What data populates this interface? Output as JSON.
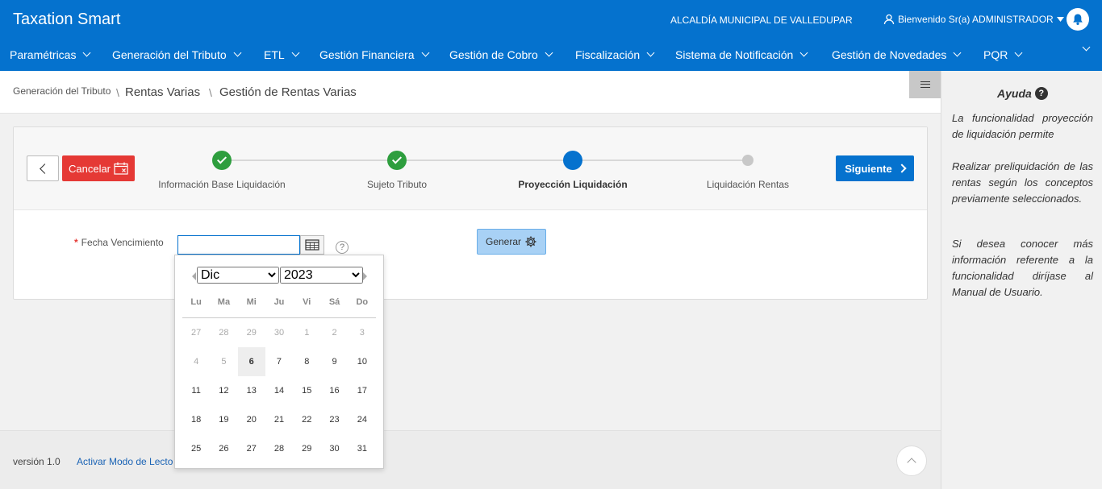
{
  "header": {
    "app_title": "Taxation Smart",
    "organization": "ALCALDÍA MUNICIPAL DE VALLEDUPAR",
    "user_greeting": "Bienvenido Sr(a) ADMINISTRADOR",
    "accent": "#0572ce"
  },
  "menu": {
    "items": [
      {
        "label": "Paramétricas"
      },
      {
        "label": "Generación del Tributo"
      },
      {
        "label": "ETL"
      },
      {
        "label": "Gestión Financiera"
      },
      {
        "label": "Gestión de Cobro"
      },
      {
        "label": "Fiscalización"
      },
      {
        "label": "Sistema de Notificación"
      },
      {
        "label": "Gestión de Novedades"
      },
      {
        "label": "PQR"
      }
    ]
  },
  "breadcrumb": {
    "level1": "Generación del Tributo",
    "level2": "Rentas Varias",
    "level3": "Gestión de Rentas Varias"
  },
  "wizard": {
    "cancel_label": "Cancelar",
    "next_label": "Siguiente",
    "steps": [
      {
        "label": "Información Base Liquidación",
        "status": "done"
      },
      {
        "label": "Sujeto Tributo",
        "status": "done"
      },
      {
        "label": "Proyección Liquidación",
        "status": "current"
      },
      {
        "label": "Liquidación Rentas",
        "status": "pending"
      }
    ]
  },
  "form": {
    "fecha_label": "Fecha Vencimiento",
    "fecha_value": "",
    "generar_label": "Generar"
  },
  "datepicker": {
    "month": "Dic",
    "year": "2023",
    "weekdays": [
      "Lu",
      "Ma",
      "Mi",
      "Ju",
      "Vi",
      "Sá",
      "Do"
    ],
    "weeks": [
      [
        "27",
        "28",
        "29",
        "30",
        "1",
        "2",
        "3"
      ],
      [
        "4",
        "5",
        "6",
        "7",
        "8",
        "9",
        "10"
      ],
      [
        "11",
        "12",
        "13",
        "14",
        "15",
        "16",
        "17"
      ],
      [
        "18",
        "19",
        "20",
        "21",
        "22",
        "23",
        "24"
      ],
      [
        "25",
        "26",
        "27",
        "28",
        "29",
        "30",
        "31"
      ]
    ]
  },
  "footer": {
    "version": "versión 1.0",
    "reader_mode": "Activar Modo de Lecto"
  },
  "help": {
    "title": "Ayuda",
    "p1": "La funcionalidad proyección de liquidación permite",
    "p2": "Realizar preliquidación de las rentas según los conceptos previamente seleccionados.",
    "p3": "Si desea conocer más información referente a la funcionalidad diríjase al Manual de Usuario."
  }
}
